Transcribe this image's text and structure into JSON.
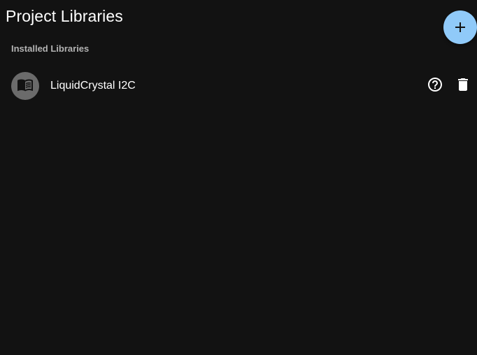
{
  "page": {
    "title": "Project Libraries"
  },
  "fab": {
    "icon": "plus-icon",
    "color": "#90caf9"
  },
  "installed": {
    "subheader": "Installed Libraries",
    "items": [
      {
        "name": "LiquidCrystal I2C",
        "icon": "book-icon",
        "actions": [
          "help-icon",
          "delete-icon"
        ]
      }
    ]
  }
}
